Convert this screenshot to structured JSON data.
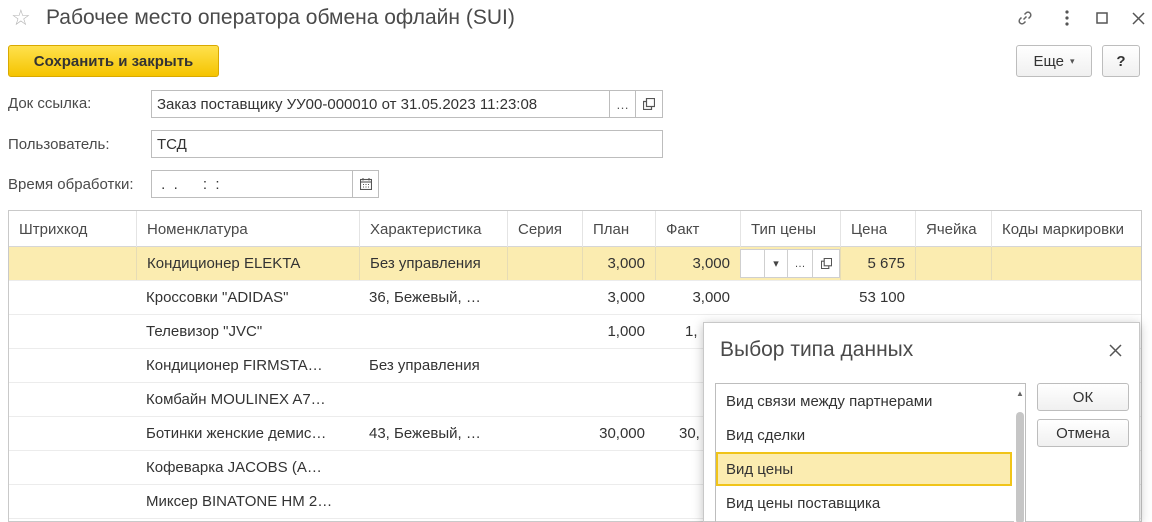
{
  "window": {
    "title": "Рабочее место оператора обмена офлайн (SUI)",
    "icons": [
      "star-icon",
      "link-icon",
      "more-vertical-icon",
      "maximize-icon",
      "close-icon"
    ]
  },
  "toolbar": {
    "save_label": "Сохранить и закрыть",
    "more_label": "Еще",
    "help_label": "?"
  },
  "form": {
    "doc_ref_label": "Док ссылка:",
    "doc_ref_value": "Заказ поставщику УУ00-000010 от 31.05.2023 11:23:08",
    "user_label": "Пользователь:",
    "user_value": "ТСД",
    "time_label": "Время обработки:",
    "time_value": " .  .      :  :"
  },
  "table": {
    "columns": [
      "Штрихкод",
      "Номенклатура",
      "Характеристика",
      "Серия",
      "План",
      "Факт",
      "Тип цены",
      "Цена",
      "Ячейка",
      "Коды маркировки"
    ],
    "rows": [
      {
        "barcode": "",
        "item": "Кондиционер ELEKTA",
        "characteristic": "Без управления",
        "series": "",
        "plan": "3,000",
        "fact": "3,000",
        "price_type": "",
        "price": "5 675",
        "cell": "",
        "codes": ""
      },
      {
        "barcode": "",
        "item": "Кроссовки \"ADIDAS\"",
        "characteristic": "36, Бежевый, …",
        "series": "",
        "plan": "3,000",
        "fact": "3,000",
        "price_type": "",
        "price": "53 100",
        "cell": "",
        "codes": ""
      },
      {
        "barcode": "",
        "item": "Телевизор \"JVC\"",
        "characteristic": "",
        "series": "",
        "plan": "1,000",
        "fact": "1,",
        "price_type": "",
        "price": "",
        "cell": "",
        "codes": ""
      },
      {
        "barcode": "",
        "item": "Кондиционер FIRMSTA…",
        "characteristic": "Без управления",
        "series": "",
        "plan": "",
        "fact": "",
        "price_type": "",
        "price": "",
        "cell": "",
        "codes": ""
      },
      {
        "barcode": "",
        "item": "Комбайн MOULINEX  A7…",
        "characteristic": "",
        "series": "",
        "plan": "",
        "fact": "",
        "price_type": "",
        "price": "",
        "cell": "",
        "codes": ""
      },
      {
        "barcode": "",
        "item": "Ботинки женские демис…",
        "characteristic": "43, Бежевый, …",
        "series": "",
        "plan": "30,000",
        "fact": "30,",
        "price_type": "",
        "price": "",
        "cell": "",
        "codes": ""
      },
      {
        "barcode": "",
        "item": "Кофеварка JACOBS (A…",
        "characteristic": "",
        "series": "",
        "plan": "",
        "fact": "",
        "price_type": "",
        "price": "",
        "cell": "",
        "codes": ""
      },
      {
        "barcode": "",
        "item": "Миксер BINATONE HM 2…",
        "characteristic": "",
        "series": "",
        "plan": "",
        "fact": "",
        "price_type": "",
        "price": "",
        "cell": "",
        "codes": ""
      }
    ],
    "selected_row": 0
  },
  "dialog": {
    "title": "Выбор типа данных",
    "items": [
      "Вид связи между партнерами",
      "Вид сделки",
      "Вид цены",
      "Вид цены поставщика"
    ],
    "selected_item": 2,
    "ok_label": "ОК",
    "cancel_label": "Отмена"
  },
  "colors": {
    "accent": "#f5c400",
    "selection": "#fbecb0",
    "selection_border": "#f0c419"
  }
}
